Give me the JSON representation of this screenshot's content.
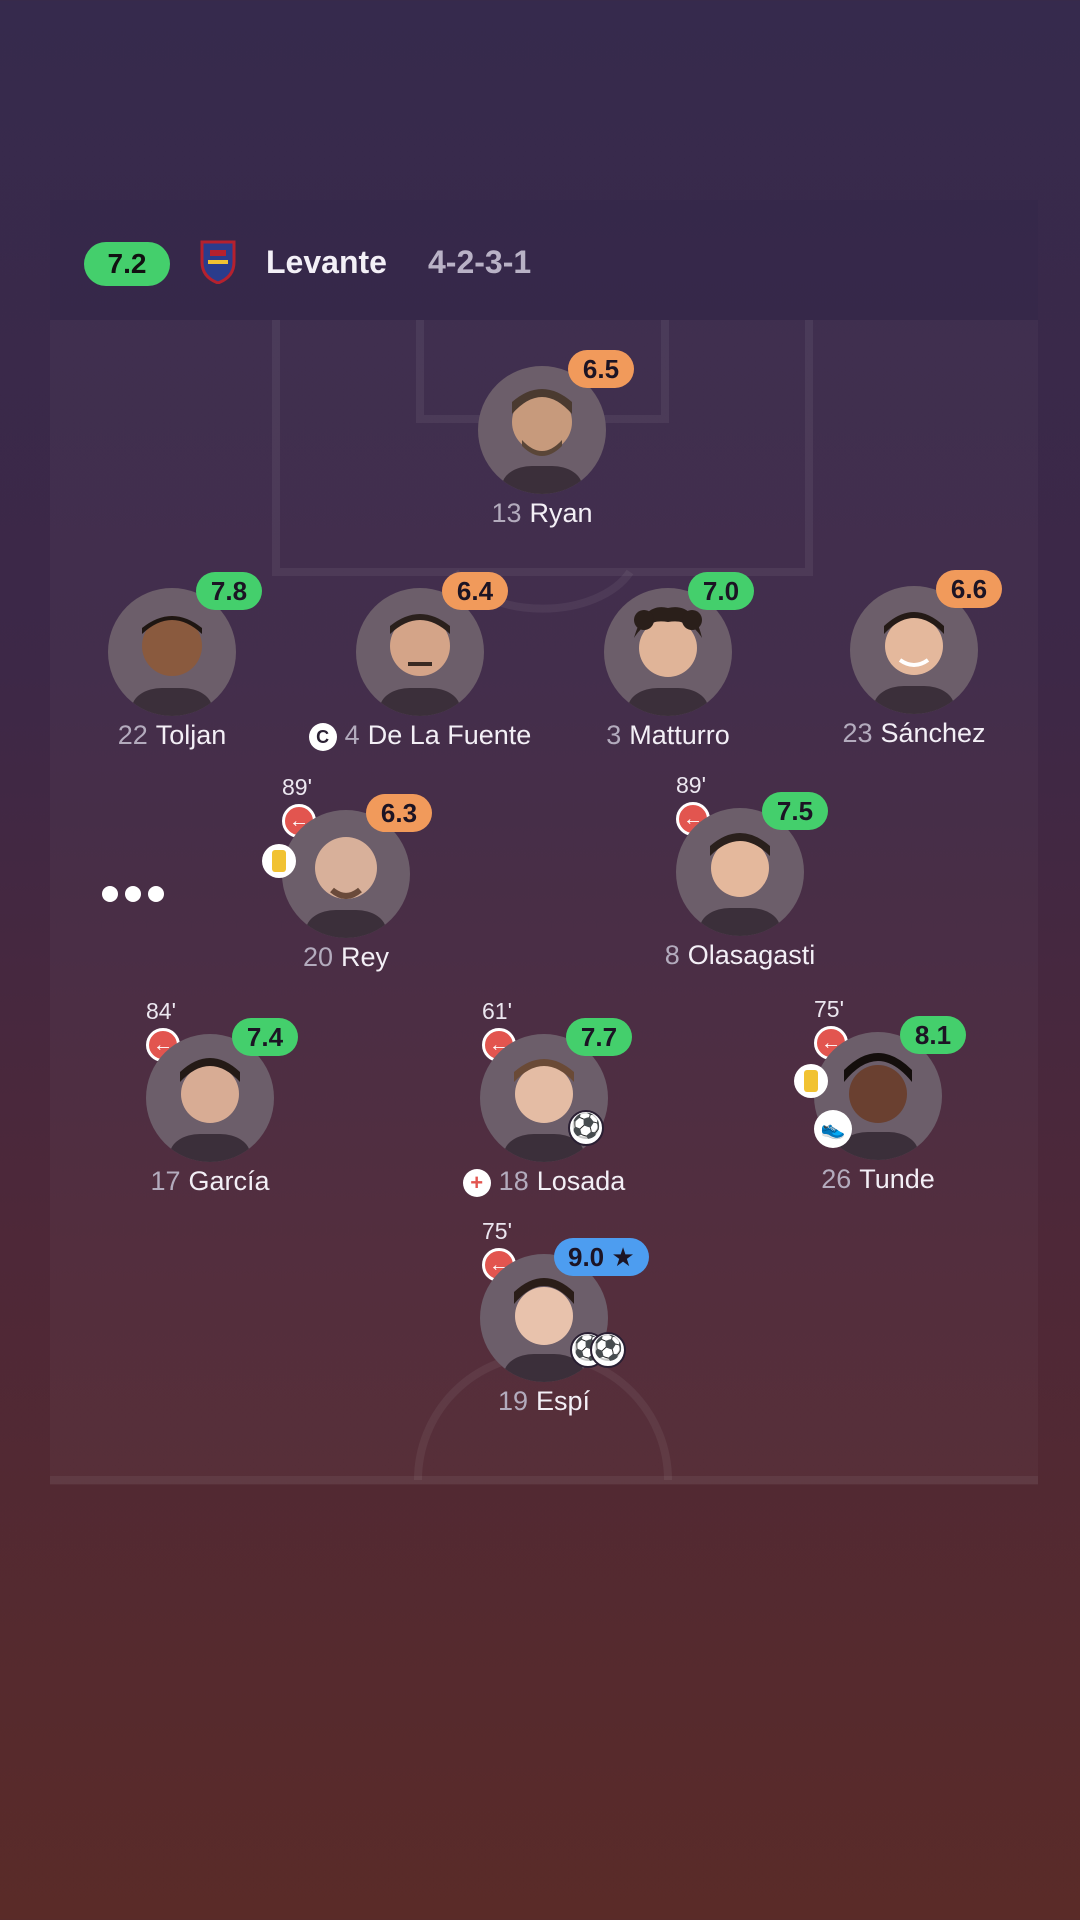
{
  "team": {
    "rating": "7.2",
    "name": "Levante",
    "formation": "4-2-3-1"
  },
  "colors": {
    "rating_orange": "#f19a5b",
    "rating_green": "#44cf6c",
    "rating_blue": "#4d9df0",
    "sub_red": "#e2554f",
    "yellow_card": "#f1c232"
  },
  "players": {
    "ryan": {
      "number": "13",
      "name": "Ryan",
      "rating": "6.5"
    },
    "toljan": {
      "number": "22",
      "name": "Toljan",
      "rating": "7.8"
    },
    "delafuente": {
      "number": "4",
      "name": "De La Fuente",
      "rating": "6.4",
      "captain_badge": "C"
    },
    "matturro": {
      "number": "3",
      "name": "Matturro",
      "rating": "7.0"
    },
    "sanchez": {
      "number": "23",
      "name": "Sánchez",
      "rating": "6.6"
    },
    "rey": {
      "number": "20",
      "name": "Rey",
      "rating": "6.3",
      "sub_minute": "89'"
    },
    "olasagasti": {
      "number": "8",
      "name": "Olasagasti",
      "rating": "7.5",
      "sub_minute": "89'"
    },
    "garcia": {
      "number": "17",
      "name": "García",
      "rating": "7.4",
      "sub_minute": "84'"
    },
    "losada": {
      "number": "18",
      "name": "Losada",
      "rating": "7.7",
      "sub_minute": "61'"
    },
    "tunde": {
      "number": "26",
      "name": "Tunde",
      "rating": "8.1",
      "sub_minute": "75'"
    },
    "espi": {
      "number": "19",
      "name": "Espí",
      "rating": "9.0 ★",
      "sub_minute": "75'"
    }
  },
  "icons": {
    "sub_out": "arrow-left-icon",
    "yellow_card": "yellow-card-icon",
    "goal": "football-icon",
    "assist": "boot-icon",
    "captain": "captain-icon",
    "injury": "injury-icon",
    "more": "more-icon"
  }
}
